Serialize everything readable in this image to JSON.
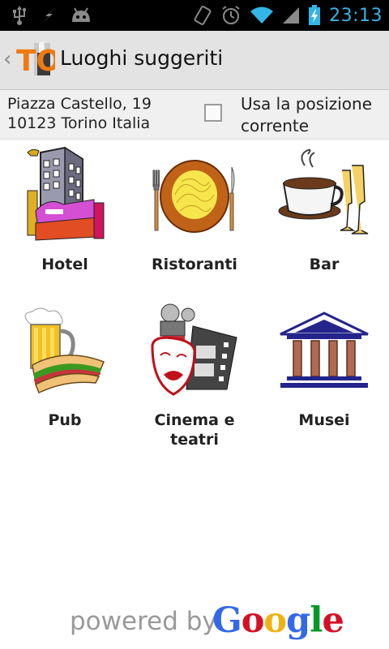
{
  "status_bar": {
    "time": "23:13",
    "icons": [
      "usb-icon",
      "lightning-icon",
      "android-icon",
      "vibrate-icon",
      "alarm-icon",
      "wifi-icon",
      "signal-icon",
      "battery-icon"
    ]
  },
  "action_bar": {
    "logo_text": "TO",
    "title": "Luoghi suggeriti"
  },
  "location": {
    "address_line1": "Piazza Castello, 19",
    "address_line2": "10123 Torino Italia",
    "use_position_line1": "Usa la posizione",
    "use_position_line2": "corrente",
    "checked": false
  },
  "categories": [
    {
      "label": "Hotel",
      "icon": "hotel-icon"
    },
    {
      "label": "Ristoranti",
      "icon": "restaurant-icon"
    },
    {
      "label": "Bar",
      "icon": "bar-icon"
    },
    {
      "label": "Pub",
      "icon": "pub-icon"
    },
    {
      "label_line1": "Cinema e",
      "label_line2": "teatri",
      "icon": "cinema-icon"
    },
    {
      "label": "Musei",
      "icon": "museum-icon"
    }
  ],
  "footer": {
    "powered_by": "powered by",
    "brand_letters": [
      "G",
      "o",
      "o",
      "g",
      "l",
      "e"
    ],
    "brand_colors": [
      "#3369e8",
      "#d50f25",
      "#eeb211",
      "#3369e8",
      "#009925",
      "#d50f25"
    ]
  },
  "colors": {
    "status_accent": "#33b5e5",
    "action_bar_bg": "#e3e3e3",
    "logo_orange": "#f07a12"
  }
}
